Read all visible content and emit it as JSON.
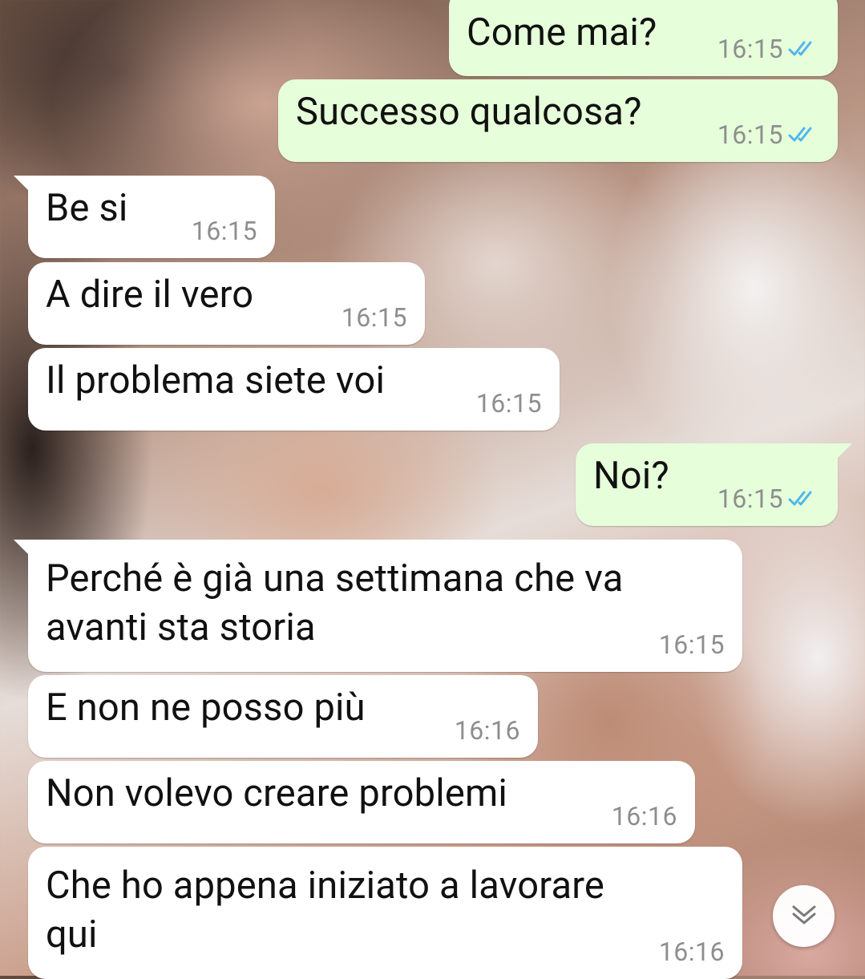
{
  "messages": [
    {
      "text": "Come mai?",
      "time": "16:15",
      "direction": "outgoing",
      "status": "read"
    },
    {
      "text": "Successo qualcosa?",
      "time": "16:15",
      "direction": "outgoing",
      "status": "read"
    },
    {
      "text": "Be si",
      "time": "16:15",
      "direction": "incoming"
    },
    {
      "text": "A dire il vero",
      "time": "16:15",
      "direction": "incoming"
    },
    {
      "text": "Il problema siete voi",
      "time": "16:15",
      "direction": "incoming"
    },
    {
      "text": "Noi?",
      "time": "16:15",
      "direction": "outgoing",
      "status": "read"
    },
    {
      "text_line1": "Perché è già una settimana che va",
      "text_line2": "avanti sta storia",
      "time": "16:15",
      "direction": "incoming"
    },
    {
      "text": "E non ne posso più",
      "time": "16:16",
      "direction": "incoming"
    },
    {
      "text": "Non volevo creare problemi",
      "time": "16:16",
      "direction": "incoming"
    },
    {
      "text_line1": "Che ho appena iniziato a lavorare",
      "text_line2": "qui",
      "time": "16:16",
      "direction": "incoming"
    }
  ],
  "colors": {
    "outgoing_bubble": "#e6ffda",
    "incoming_bubble": "#ffffff",
    "read_tick": "#4fb6ec",
    "time_text": "#8e8e8e"
  },
  "scroll_button": {
    "icon": "double-chevron-down-icon"
  }
}
